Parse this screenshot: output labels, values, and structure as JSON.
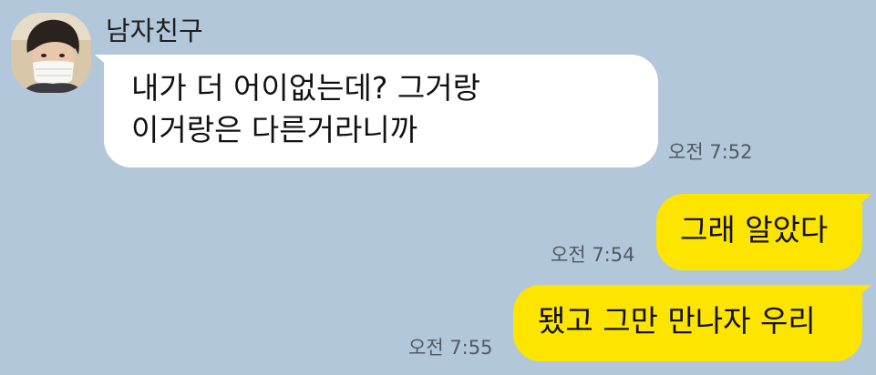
{
  "colors": {
    "background": "#b2c7da",
    "incoming_bubble": "#ffffff",
    "outgoing_bubble": "#fee500"
  },
  "sender": {
    "name": "남자친구",
    "avatar_icon": "profile-photo-person-with-mask"
  },
  "messages": [
    {
      "direction": "incoming",
      "lines": [
        "내가 더 어이없는데? 그거랑",
        "이거랑은 다른거라니까"
      ],
      "time": "오전 7:52"
    },
    {
      "direction": "outgoing",
      "text": "그래 알았다",
      "time": "오전 7:54"
    },
    {
      "direction": "outgoing",
      "text": "됐고 그만 만나자 우리",
      "time": "오전 7:55"
    }
  ]
}
